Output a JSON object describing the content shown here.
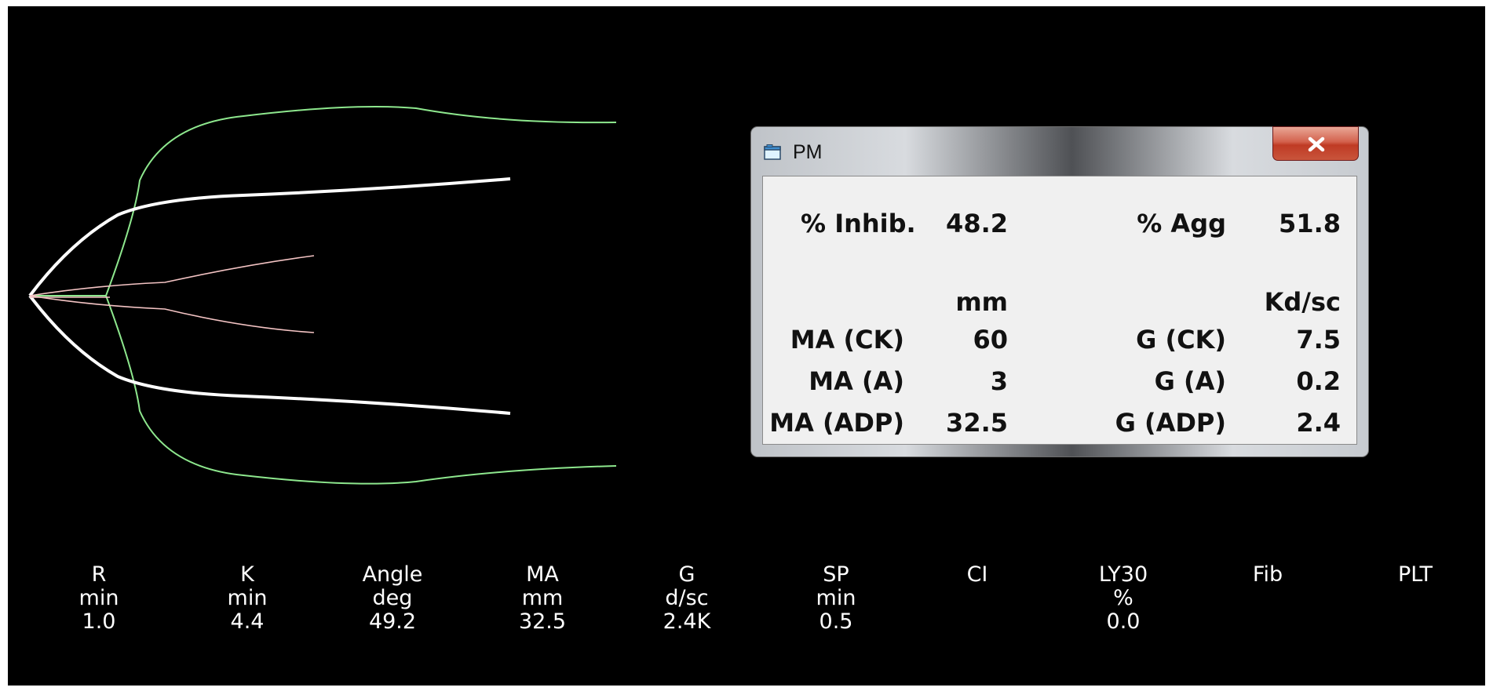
{
  "colors": {
    "background": "#000000",
    "trace_blood_ck": "#ffffff",
    "trace_green": "#8ee88e",
    "trace_pink": "#f4c4c4"
  },
  "dialog": {
    "title": "PM",
    "icon": "window-app-icon",
    "close_icon": "close-x-icon",
    "inhib_label": "% Inhib.",
    "inhib_value": "48.2",
    "agg_label": "% Agg",
    "agg_value": "51.8",
    "unit_left": "mm",
    "unit_right": "Kd/sc",
    "rows": [
      {
        "ma_label": "MA (CK)",
        "ma_value": "60",
        "g_label": "G (CK)",
        "g_value": "7.5"
      },
      {
        "ma_label": "MA (A)",
        "ma_value": "3",
        "g_label": "G (A)",
        "g_value": "0.2"
      },
      {
        "ma_label": "MA (ADP)",
        "ma_value": "32.5",
        "g_label": "G (ADP)",
        "g_value": "2.4"
      }
    ]
  },
  "params": [
    {
      "name": "R",
      "unit": "min",
      "value": "1.0"
    },
    {
      "name": "K",
      "unit": "min",
      "value": "4.4"
    },
    {
      "name": "Angle",
      "unit": "deg",
      "value": "49.2"
    },
    {
      "name": "MA",
      "unit": "mm",
      "value": "32.5"
    },
    {
      "name": "G",
      "unit": "d/sc",
      "value": "2.4K"
    },
    {
      "name": "SP",
      "unit": "min",
      "value": "0.5"
    },
    {
      "name": "CI",
      "unit": "",
      "value": ""
    },
    {
      "name": "LY30",
      "unit": "%",
      "value": "0.0"
    },
    {
      "name": "Fib",
      "unit": "",
      "value": ""
    },
    {
      "name": "PLT",
      "unit": "",
      "value": ""
    }
  ]
}
